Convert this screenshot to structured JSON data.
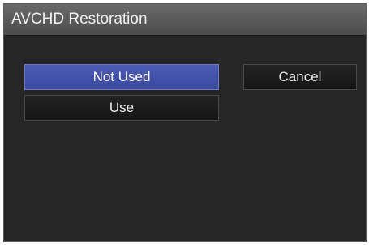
{
  "dialog": {
    "title": "AVCHD Restoration"
  },
  "options": {
    "not_used_label": "Not Used",
    "use_label": "Use",
    "selected": "Not Used"
  },
  "actions": {
    "cancel_label": "Cancel"
  },
  "colors": {
    "selected_highlight": "#4453aa",
    "background": "#262626"
  }
}
